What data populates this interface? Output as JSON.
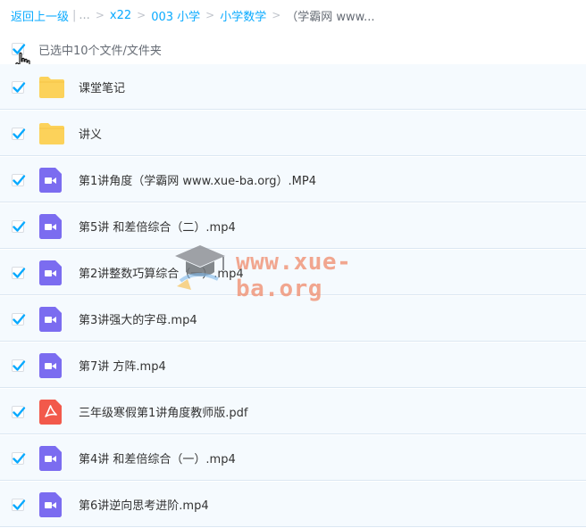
{
  "breadcrumb": {
    "back": "返回上一级",
    "ellipsis": "...",
    "items": [
      "x22",
      "003 小学",
      "小学数学"
    ],
    "current": "（学霸网 www..."
  },
  "selection": {
    "label": "已选中10个文件/文件夹"
  },
  "files": [
    {
      "name": "课堂笔记",
      "icon": "folder-icon"
    },
    {
      "name": "讲义",
      "icon": "folder-icon"
    },
    {
      "name": "第1讲角度（学霸网 www.xue-ba.org）.MP4",
      "icon": "video-icon"
    },
    {
      "name": "第5讲 和差倍综合（二）.mp4",
      "icon": "video-icon"
    },
    {
      "name": "第2讲整数巧算综合（一）.mp4",
      "icon": "video-icon"
    },
    {
      "name": "第3讲强大的字母.mp4",
      "icon": "video-icon"
    },
    {
      "name": "第7讲 方阵.mp4",
      "icon": "video-icon"
    },
    {
      "name": "三年级寒假第1讲角度教师版.pdf",
      "icon": "pdf-icon"
    },
    {
      "name": "第4讲 和差倍综合（一）.mp4",
      "icon": "video-icon"
    },
    {
      "name": "第6讲逆向思考进阶.mp4",
      "icon": "video-icon"
    }
  ],
  "watermark": {
    "text": "www.xue-ba.org"
  },
  "colors": {
    "link": "#09aaff",
    "check": "#09aaff",
    "folder": "#fcd25a",
    "video": "#7b6cf0",
    "pdf": "#f2594b",
    "row_bg": "#f5fafe"
  }
}
